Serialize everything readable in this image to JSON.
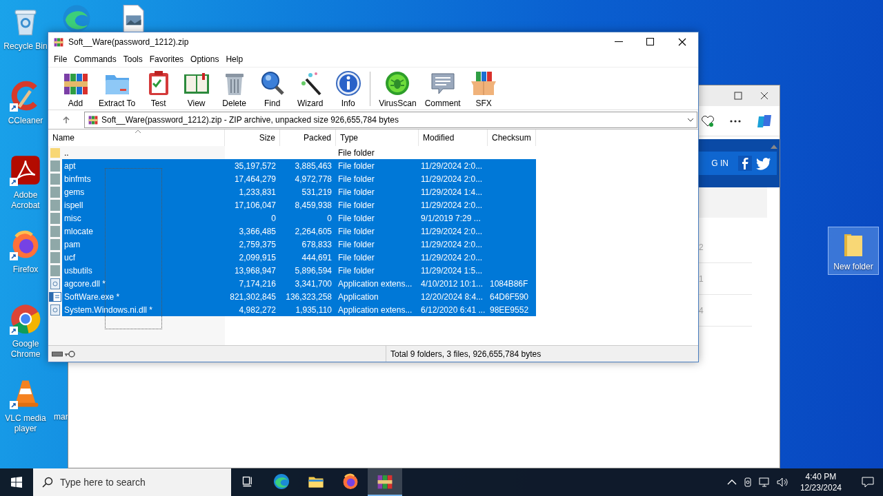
{
  "desktop": {
    "icons": [
      {
        "label": "Recycle Bin",
        "kind": "recycle",
        "shortcut": false
      },
      {
        "label": "CCleaner",
        "kind": "ccleaner",
        "shortcut": true
      },
      {
        "label": "Adobe Acrobat",
        "kind": "acrobat",
        "shortcut": true
      },
      {
        "label": "Firefox",
        "kind": "firefox",
        "shortcut": true
      },
      {
        "label": "Google Chrome",
        "kind": "chrome",
        "shortcut": true
      },
      {
        "label": "VLC media player",
        "kind": "vlc",
        "shortcut": true
      }
    ],
    "top_icons": [
      {
        "kind": "edge"
      },
      {
        "kind": "image"
      }
    ],
    "cut_label": "mar",
    "new_folder": {
      "label": "New folder",
      "selected": true
    }
  },
  "browser": {
    "login": "G IN",
    "row_numbers": [
      "2",
      "1",
      "4"
    ]
  },
  "winrar": {
    "title": "Soft__Ware(password_1212).zip",
    "menu": [
      "File",
      "Commands",
      "Tools",
      "Favorites",
      "Options",
      "Help"
    ],
    "toolbar": [
      {
        "label": "Add",
        "kind": "add"
      },
      {
        "label": "Extract To",
        "kind": "extract"
      },
      {
        "label": "Test",
        "kind": "test"
      },
      {
        "label": "View",
        "kind": "view"
      },
      {
        "label": "Delete",
        "kind": "delete"
      },
      {
        "label": "Find",
        "kind": "find"
      },
      {
        "label": "Wizard",
        "kind": "wizard"
      },
      {
        "label": "Info",
        "kind": "info"
      },
      {
        "kind": "separator"
      },
      {
        "label": "VirusScan",
        "kind": "virusscan"
      },
      {
        "label": "Comment",
        "kind": "comment"
      },
      {
        "label": "SFX",
        "kind": "sfx"
      }
    ],
    "address": "Soft__Ware(password_1212).zip - ZIP archive, unpacked size 926,655,784 bytes",
    "columns": [
      "Name",
      "Size",
      "Packed",
      "Type",
      "Modified",
      "Checksum"
    ],
    "rows": [
      {
        "kind": "parent",
        "name": "..",
        "size": "",
        "packed": "",
        "type": "File folder",
        "modified": "",
        "checksum": "",
        "selected": false
      },
      {
        "kind": "folder",
        "name": "apt",
        "size": "35,197,572",
        "packed": "3,885,463",
        "type": "File folder",
        "modified": "11/29/2024 2:0...",
        "checksum": "",
        "selected": true
      },
      {
        "kind": "folder",
        "name": "binfmts",
        "size": "17,464,279",
        "packed": "4,972,778",
        "type": "File folder",
        "modified": "11/29/2024 2:0...",
        "checksum": "",
        "selected": true
      },
      {
        "kind": "folder",
        "name": "gems",
        "size": "1,233,831",
        "packed": "531,219",
        "type": "File folder",
        "modified": "11/29/2024 1:4...",
        "checksum": "",
        "selected": true
      },
      {
        "kind": "folder",
        "name": "ispell",
        "size": "17,106,047",
        "packed": "8,459,938",
        "type": "File folder",
        "modified": "11/29/2024 2:0...",
        "checksum": "",
        "selected": true
      },
      {
        "kind": "folder",
        "name": "misc",
        "size": "0",
        "packed": "0",
        "type": "File folder",
        "modified": "9/1/2019 7:29 ...",
        "checksum": "",
        "selected": true
      },
      {
        "kind": "folder",
        "name": "mlocate",
        "size": "3,366,485",
        "packed": "2,264,605",
        "type": "File folder",
        "modified": "11/29/2024 2:0...",
        "checksum": "",
        "selected": true
      },
      {
        "kind": "folder",
        "name": "pam",
        "size": "2,759,375",
        "packed": "678,833",
        "type": "File folder",
        "modified": "11/29/2024 2:0...",
        "checksum": "",
        "selected": true
      },
      {
        "kind": "folder",
        "name": "ucf",
        "size": "2,099,915",
        "packed": "444,691",
        "type": "File folder",
        "modified": "11/29/2024 2:0...",
        "checksum": "",
        "selected": true
      },
      {
        "kind": "folder",
        "name": "usbutils",
        "size": "13,968,947",
        "packed": "5,896,594",
        "type": "File folder",
        "modified": "11/29/2024 1:5...",
        "checksum": "",
        "selected": true
      },
      {
        "kind": "dll",
        "name": "agcore.dll *",
        "size": "7,174,216",
        "packed": "3,341,700",
        "type": "Application extens...",
        "modified": "4/10/2012 10:1...",
        "checksum": "1084B86F",
        "selected": true
      },
      {
        "kind": "exe",
        "name": "SoftWare.exe *",
        "size": "821,302,845",
        "packed": "136,323,258",
        "type": "Application",
        "modified": "12/20/2024 8:4...",
        "checksum": "64D6F590",
        "selected": true
      },
      {
        "kind": "dll",
        "name": "System.Windows.ni.dll *",
        "size": "4,982,272",
        "packed": "1,935,110",
        "type": "Application extens...",
        "modified": "6/12/2020 6:41 ...",
        "checksum": "98EE9552",
        "selected": true
      }
    ],
    "status": "Total 9 folders, 3 files, 926,655,784 bytes"
  },
  "taskbar": {
    "search_placeholder": "Type here to search",
    "apps": [
      {
        "kind": "taskview",
        "active": false
      },
      {
        "kind": "edge",
        "active": false
      },
      {
        "kind": "explorer",
        "active": false
      },
      {
        "kind": "firefox",
        "active": false
      },
      {
        "kind": "winrar",
        "active": true
      }
    ],
    "time": "4:40 PM",
    "date": "12/23/2024"
  }
}
